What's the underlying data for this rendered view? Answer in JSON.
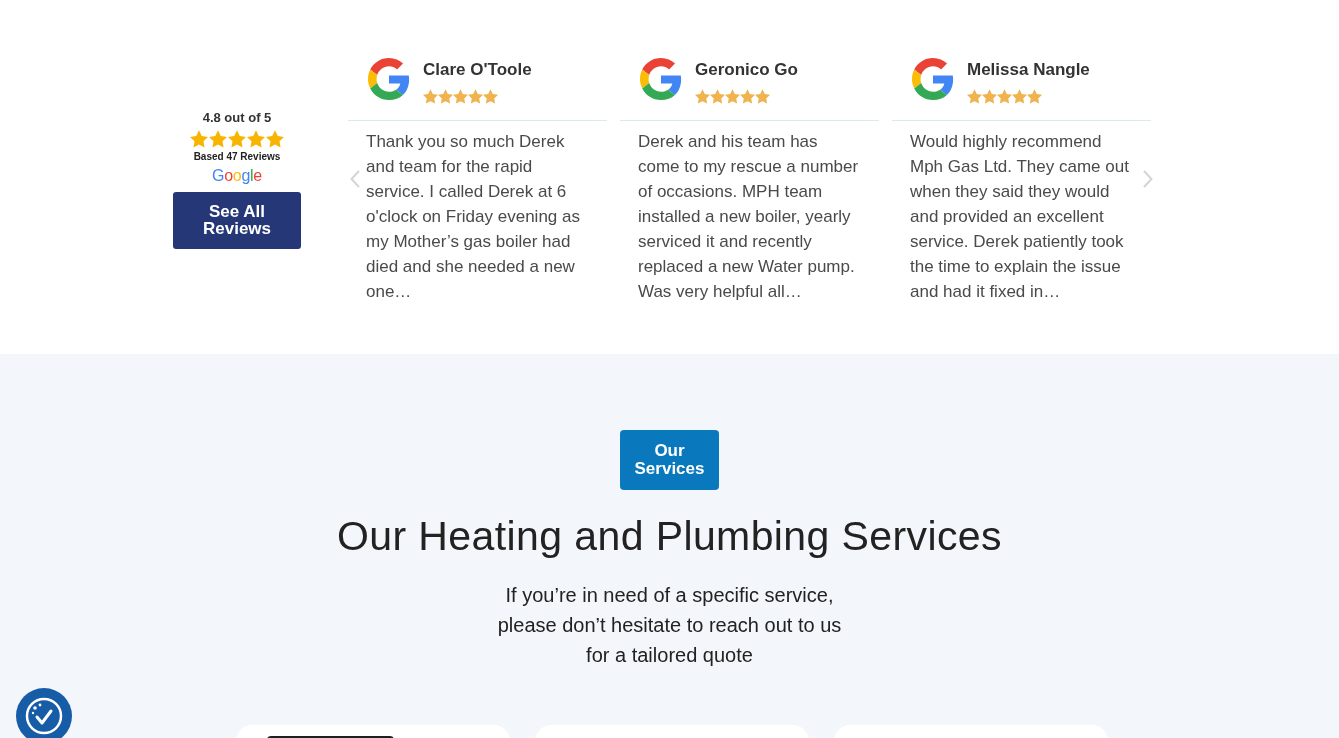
{
  "rating_summary": {
    "score": "4.8 out of 5",
    "stars": 5,
    "count": "Based 47 Reviews",
    "source": "Google",
    "button": "See All Reviews"
  },
  "reviews": [
    {
      "name": "Clare O'Toole",
      "stars": 5,
      "text": "Thank you so much Derek and team for the rapid service. I called Derek at 6 o'clock on Friday evening as my Mother’s gas boiler had died and she needed a new one…"
    },
    {
      "name": "Geronico Go",
      "stars": 5,
      "text": "Derek and his team has come to my rescue a number of occasions. MPH team installed a new boiler, yearly serviced it and recently replaced a new Water pump. Was very helpful all…"
    },
    {
      "name": "Melissa Nangle",
      "stars": 5,
      "text": "Would highly recommend Mph Gas Ltd. They came out when they said they would and provided an excellent service. Derek patiently took the time to explain the issue and had it fixed in…"
    }
  ],
  "services": {
    "badge": "Our Services",
    "heading": "Our Heating and Plumbing Services",
    "intro": "If you’re in need of a specific service, please don’t hesitate to reach out to us for a tailored quote",
    "cards": [
      {
        "kind": "image"
      },
      {
        "kind": "plain"
      },
      {
        "kind": "plain"
      }
    ]
  }
}
